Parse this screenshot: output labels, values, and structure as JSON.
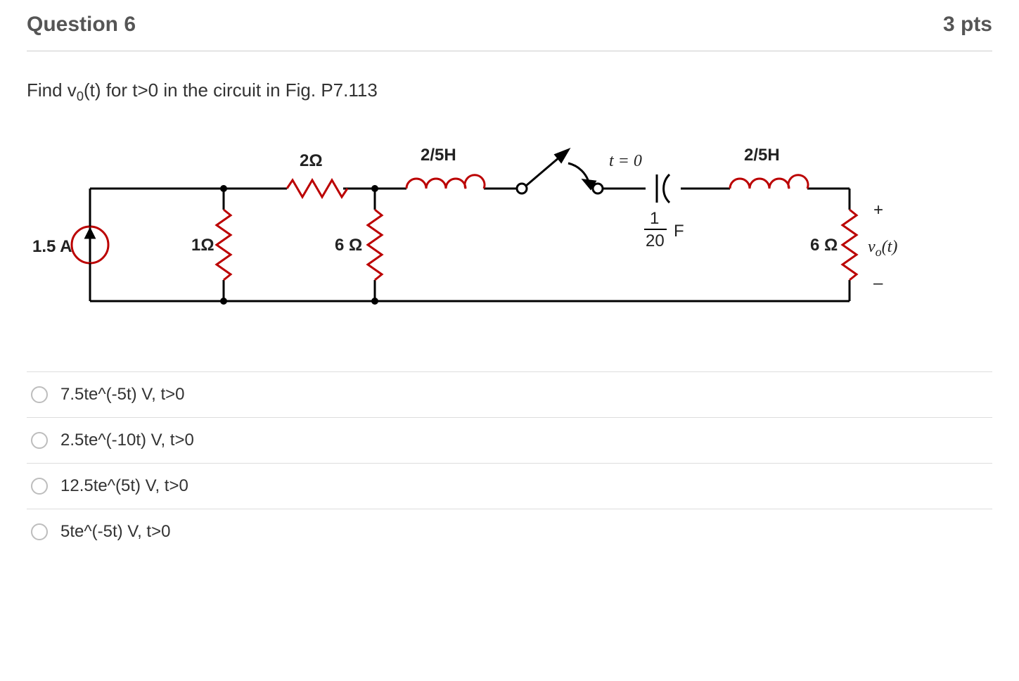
{
  "header": {
    "title": "Question 6",
    "points": "3 pts"
  },
  "prompt": {
    "pre": "Find v",
    "sub": "0",
    "post": "(t) for t>0 in the circuit in Fig. P7.113"
  },
  "circuit": {
    "src_current": "1.5 A",
    "r1": "1Ω",
    "r2_top": "2Ω",
    "r3": "6 Ω",
    "L1": "2/5H",
    "switch_time": "t = 0",
    "cap": {
      "num": "1",
      "den": "20",
      "unit": "F"
    },
    "L2": "2/5H",
    "r4": "6 Ω",
    "vo": "v",
    "vo_sub": "o",
    "vo_arg": "(t)",
    "plus": "+",
    "minus": "–"
  },
  "choices": [
    "7.5te^(-5t) V, t>0",
    "2.5te^(-10t) V, t>0",
    "12.5te^(5t) V, t>0",
    "5te^(-5t) V, t>0"
  ]
}
